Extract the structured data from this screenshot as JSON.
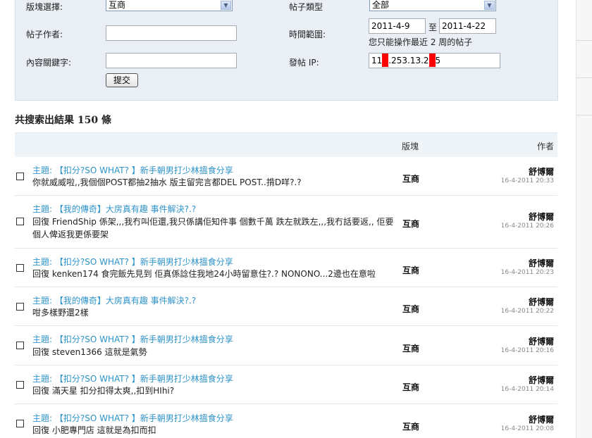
{
  "search": {
    "forum_label": "版塊選擇:",
    "forum_value": "互商",
    "type_label": "帖子類型",
    "type_value": "全部",
    "author_label": "帖子作者:",
    "author_value": "",
    "range_label": "時間範圍:",
    "date_from": "2011-4-9",
    "date_to_sep": "至",
    "date_to": "2011-4-22",
    "range_note": "您只能操作最近 2 周的帖子",
    "keyword_label": "內容關鍵字:",
    "keyword_value": "",
    "ip_label": "發帖 IP:",
    "ip_part1": "11",
    "ip_part2": ".253.13.2",
    "ip_part3": "5",
    "submit_label": "提交"
  },
  "results": {
    "summary": "共搜索出結果 150 條",
    "col_forum": "版塊",
    "col_author": "作者",
    "rows": [
      {
        "title": "主題: 【扣分?SO WHAT? 】新手朝男打少林搵食分享",
        "snippet": "你就威威啦,,我個個POST都抽2抽水 版主留完言都DEL POST..揹D咩?.?",
        "forum": "互商",
        "author": "舒博爾",
        "time": "16-4-2011 20:33"
      },
      {
        "title": "主題: 【我的傳奇】大房真有趣 事件解決?.?",
        "snippet": "回復 FriendShip 係架,,,我冇叫佢還,我只係講佢知件事 個數千萬 跌左就跌左,,,我冇話要返,, 佢要個人俾返我更係要架",
        "forum": "互商",
        "author": "舒博爾",
        "time": "16-4-2011 20:26"
      },
      {
        "title": "主題: 【扣分?SO WHAT? 】新手朝男打少林搵食分享",
        "snippet": "回復 kenken174 食完飯先見到 佢真係諗住我地24小時留意住?.? NONONO...2邊也在意啦",
        "forum": "互商",
        "author": "舒博爾",
        "time": "16-4-2011 20:23"
      },
      {
        "title": "主題: 【我的傳奇】大房真有趣 事件解決?.?",
        "snippet": "咁多樣野還2樣",
        "forum": "互商",
        "author": "舒博爾",
        "time": "16-4-2011 20:22"
      },
      {
        "title": "主題: 【扣分?SO WHAT? 】新手朝男打少林搵食分享",
        "snippet": "回復 steven1366 這就是氣勢",
        "forum": "互商",
        "author": "舒博爾",
        "time": "16-4-2011 20:16"
      },
      {
        "title": "主題: 【扣分?SO WHAT? 】新手朝男打少林搵食分享",
        "snippet": "回復 滿天星 扣分扣得太爽,,扣到HIhi?",
        "forum": "互商",
        "author": "舒博爾",
        "time": "16-4-2011 20:14"
      },
      {
        "title": "主題: 【扣分?SO WHAT? 】新手朝男打少林搵食分享",
        "snippet": "回復 小肥專門店 這就是為扣而扣",
        "forum": "互商",
        "author": "舒博爾",
        "time": "16-4-2011 20:08"
      }
    ]
  }
}
